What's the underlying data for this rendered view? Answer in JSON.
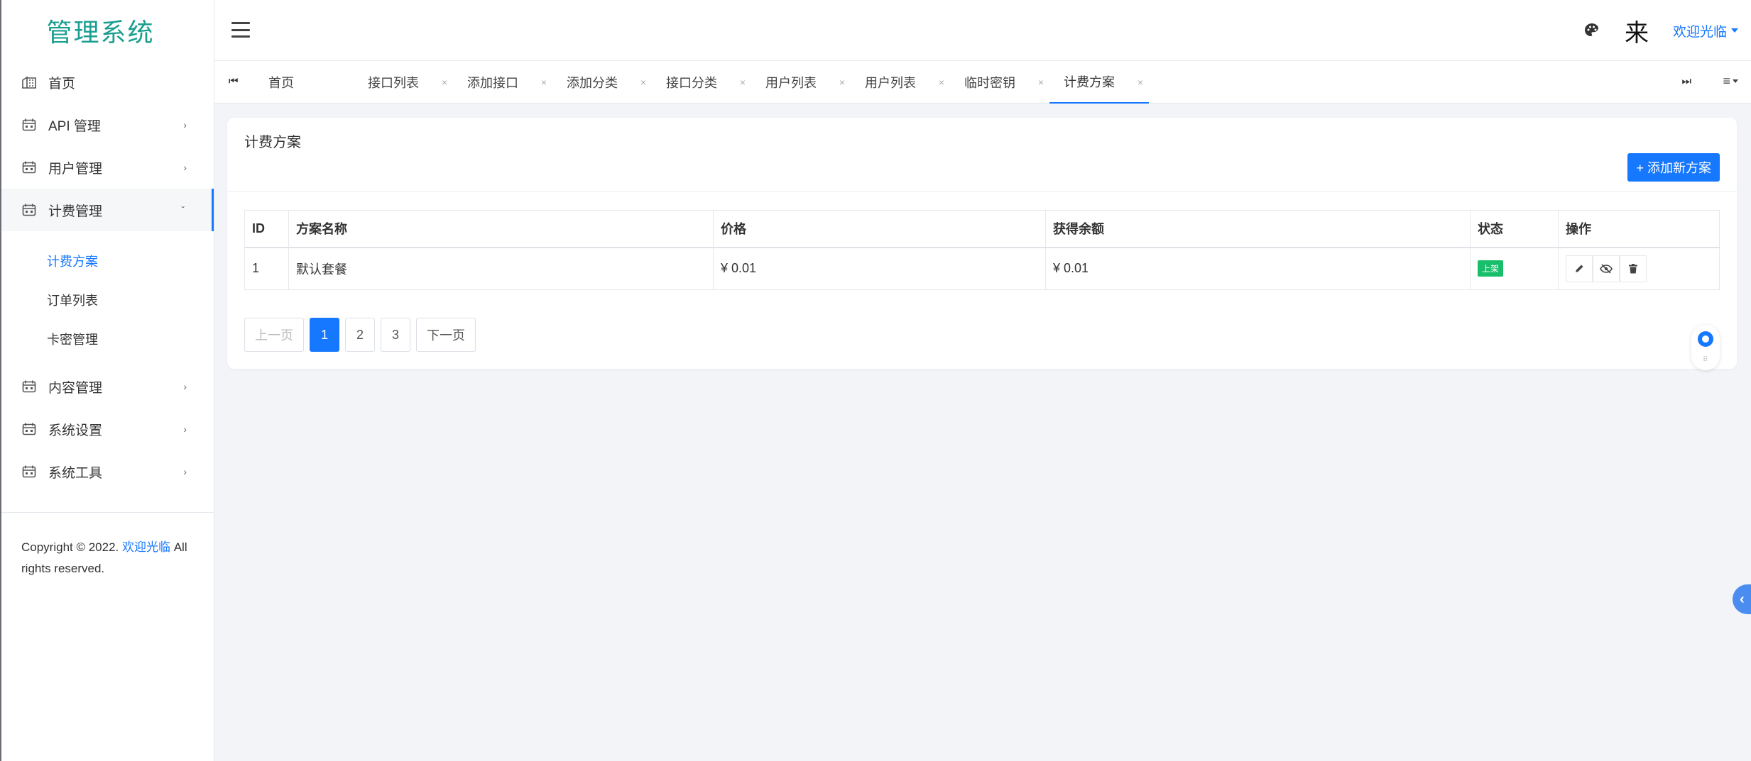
{
  "sidebar": {
    "logo": "管理系统",
    "items": [
      {
        "label": "首页",
        "icon": "home-icon"
      },
      {
        "label": "API 管理",
        "icon": "calendar-icon"
      },
      {
        "label": "用户管理",
        "icon": "calendar-icon"
      },
      {
        "label": "计费管理",
        "icon": "calendar-icon"
      },
      {
        "label": "内容管理",
        "icon": "calendar-icon"
      },
      {
        "label": "系统设置",
        "icon": "calendar-icon"
      },
      {
        "label": "系统工具",
        "icon": "calendar-icon"
      }
    ],
    "sub_items": [
      "计费方案",
      "订单列表",
      "卡密管理"
    ],
    "footer": {
      "prefix": "Copyright © 2022. ",
      "link": "欢迎光临",
      "suffix": " All rights reserved."
    }
  },
  "header": {
    "lai": "来",
    "welcome": "欢迎光临"
  },
  "tabs": {
    "items": [
      "首页",
      "接口列表",
      "添加接口",
      "添加分类",
      "接口分类",
      "用户列表",
      "用户列表",
      "临时密钥",
      "计费方案"
    ],
    "first_icon": "⏮",
    "last_icon": "⏭",
    "menu_icon": "≡"
  },
  "page": {
    "title": "计费方案",
    "add_button": "+ 添加新方案",
    "columns": [
      "ID",
      "方案名称",
      "价格",
      "获得余额",
      "状态",
      "操作"
    ],
    "rows": [
      {
        "id": "1",
        "name": "默认套餐",
        "price": "¥ 0.01",
        "balance": "¥ 0.01",
        "status": "上架"
      }
    ],
    "pager": {
      "prev": "上一页",
      "pages": [
        "1",
        "2",
        "3"
      ],
      "next": "下一页",
      "current": "1"
    }
  },
  "colors": {
    "accent": "#1677ff",
    "logo": "#1a9e8f",
    "status_green": "#19be6b"
  }
}
